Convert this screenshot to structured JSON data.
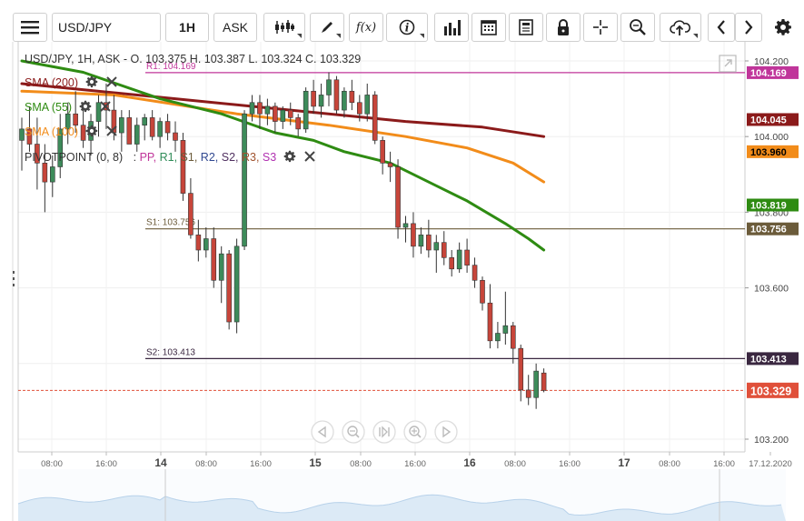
{
  "toolbar": {
    "menu_icon": "hamburger-menu-icon",
    "symbol": "USD/JPY",
    "timeframe": "1H",
    "price_type": "ASK",
    "chart_type_icon": "candlestick-chart-icon",
    "draw_icon": "pencil-icon",
    "indicator_label": "f(x)",
    "info_icon": "info-icon",
    "volume_icon": "bar-chart-icon",
    "calendar_icon": "calendar-icon",
    "news_icon": "news-icon",
    "lock_icon": "lock-icon",
    "crosshair_icon": "crosshair-icon",
    "zoom_icon": "zoom-search-icon",
    "upload_icon": "cloud-upload-icon",
    "prev_icon": "chevron-left-icon",
    "next_icon": "chevron-right-icon",
    "settings_icon": "gear-icon"
  },
  "chart_header": {
    "text": "USD/JPY, 1H, ASK - O. 103.375 H. 103.387 L. 103.324 C. 103.329"
  },
  "indicators": [
    {
      "name": "SMA (200)",
      "color": "#8b1a1a"
    },
    {
      "name": "SMA (55)",
      "color": "#2e8b12"
    },
    {
      "name": "SMA (100)",
      "color": "#f28c1a"
    }
  ],
  "pivot": {
    "title": "PIVOTPOINT (0, 8)",
    "separator": ":",
    "items": [
      {
        "label": "PP,",
        "color": "#c0359a"
      },
      {
        "label": "R1,",
        "color": "#2e8b57"
      },
      {
        "label": "S1,",
        "color": "#6b5b3a"
      },
      {
        "label": "R2,",
        "color": "#304890"
      },
      {
        "label": "S2,",
        "color": "#503060"
      },
      {
        "label": "R3,",
        "color": "#a0522d"
      },
      {
        "label": "S3",
        "color": "#b030b0"
      }
    ]
  },
  "levels": {
    "r1_label": "R1: 104.169",
    "s1_label": "S1: 103.756",
    "s2_label": "S2: 103.413"
  },
  "price_axis": {
    "ticks": [
      "104.200",
      "104.000",
      "103.800",
      "103.600",
      "103.200"
    ],
    "badges": [
      {
        "value": "104.169",
        "price": 104.169,
        "bg": "#c0359a",
        "fg": "#fff"
      },
      {
        "value": "104.045",
        "price": 104.045,
        "bg": "#8b1a1a",
        "fg": "#fff"
      },
      {
        "value": "103.960",
        "price": 103.96,
        "bg": "#f28c1a",
        "fg": "#000"
      },
      {
        "value": "103.819",
        "price": 103.819,
        "bg": "#2e8b12",
        "fg": "#fff"
      },
      {
        "value": "103.756",
        "price": 103.756,
        "bg": "#6b5b3a",
        "fg": "#fff"
      },
      {
        "value": "103.413",
        "price": 103.413,
        "bg": "#3a2740",
        "fg": "#fff"
      },
      {
        "value": "103.329",
        "price": 103.329,
        "bg": "#e0503a",
        "fg": "#fff"
      }
    ]
  },
  "time_axis": {
    "labels": [
      "08:00",
      "16:00",
      "14",
      "08:00",
      "16:00",
      "15",
      "08:00",
      "16:00",
      "16",
      "08:00",
      "16:00",
      "17",
      "08:00",
      "16:00",
      "17.12.2020"
    ]
  },
  "nav_controls": [
    "scroll-left-icon",
    "zoom-out-icon",
    "fit-icon",
    "zoom-in-icon",
    "scroll-right-icon"
  ],
  "colors": {
    "bull": "#3d8b5a",
    "bear": "#c7453a",
    "grid": "#ececec",
    "last_price_line": "#e0503a"
  },
  "chart_data": {
    "type": "candlestick",
    "symbol": "USD/JPY",
    "timeframe": "1H",
    "ylim": [
      103.18,
      104.24
    ],
    "candles": [
      {
        "o": 103.99,
        "h": 104.05,
        "l": 103.91,
        "c": 104.02
      },
      {
        "o": 104.02,
        "h": 104.08,
        "l": 103.96,
        "c": 103.98
      },
      {
        "o": 103.98,
        "h": 104.05,
        "l": 103.86,
        "c": 103.93
      },
      {
        "o": 103.93,
        "h": 103.98,
        "l": 103.8,
        "c": 103.88
      },
      {
        "o": 103.88,
        "h": 103.95,
        "l": 103.84,
        "c": 103.92
      },
      {
        "o": 103.92,
        "h": 104.06,
        "l": 103.89,
        "c": 104.02
      },
      {
        "o": 104.02,
        "h": 104.09,
        "l": 103.98,
        "c": 104.06
      },
      {
        "o": 104.06,
        "h": 104.12,
        "l": 104.01,
        "c": 104.03
      },
      {
        "o": 104.03,
        "h": 104.09,
        "l": 103.97,
        "c": 103.99
      },
      {
        "o": 103.99,
        "h": 104.06,
        "l": 103.95,
        "c": 104.04
      },
      {
        "o": 104.04,
        "h": 104.11,
        "l": 104.0,
        "c": 104.09
      },
      {
        "o": 104.09,
        "h": 104.14,
        "l": 104.02,
        "c": 104.07
      },
      {
        "o": 104.07,
        "h": 104.11,
        "l": 103.99,
        "c": 104.01
      },
      {
        "o": 104.01,
        "h": 104.07,
        "l": 103.96,
        "c": 104.05
      },
      {
        "o": 104.05,
        "h": 104.07,
        "l": 103.98,
        "c": 103.98
      },
      {
        "o": 103.98,
        "h": 104.05,
        "l": 103.96,
        "c": 104.03
      },
      {
        "o": 104.03,
        "h": 104.06,
        "l": 103.99,
        "c": 104.05
      },
      {
        "o": 104.05,
        "h": 104.07,
        "l": 103.99,
        "c": 104.0
      },
      {
        "o": 104.0,
        "h": 104.05,
        "l": 103.97,
        "c": 104.04
      },
      {
        "o": 104.04,
        "h": 104.06,
        "l": 103.99,
        "c": 104.01
      },
      {
        "o": 104.01,
        "h": 104.04,
        "l": 103.96,
        "c": 103.99
      },
      {
        "o": 103.99,
        "h": 104.01,
        "l": 103.83,
        "c": 103.85
      },
      {
        "o": 103.85,
        "h": 103.89,
        "l": 103.73,
        "c": 103.74
      },
      {
        "o": 103.74,
        "h": 103.78,
        "l": 103.67,
        "c": 103.7
      },
      {
        "o": 103.7,
        "h": 103.76,
        "l": 103.68,
        "c": 103.73
      },
      {
        "o": 103.73,
        "h": 103.76,
        "l": 103.6,
        "c": 103.62
      },
      {
        "o": 103.62,
        "h": 103.71,
        "l": 103.56,
        "c": 103.69
      },
      {
        "o": 103.69,
        "h": 103.7,
        "l": 103.49,
        "c": 103.51
      },
      {
        "o": 103.51,
        "h": 103.73,
        "l": 103.48,
        "c": 103.71
      },
      {
        "o": 103.71,
        "h": 104.07,
        "l": 103.7,
        "c": 104.06
      },
      {
        "o": 104.06,
        "h": 104.11,
        "l": 104.04,
        "c": 104.09
      },
      {
        "o": 104.09,
        "h": 104.11,
        "l": 104.02,
        "c": 104.06
      },
      {
        "o": 104.06,
        "h": 104.1,
        "l": 104.03,
        "c": 104.08
      },
      {
        "o": 104.08,
        "h": 104.09,
        "l": 104.01,
        "c": 104.04
      },
      {
        "o": 104.04,
        "h": 104.08,
        "l": 104.02,
        "c": 104.07
      },
      {
        "o": 104.07,
        "h": 104.09,
        "l": 104.03,
        "c": 104.05
      },
      {
        "o": 104.05,
        "h": 104.06,
        "l": 104.0,
        "c": 104.02
      },
      {
        "o": 104.02,
        "h": 104.13,
        "l": 104.01,
        "c": 104.12
      },
      {
        "o": 104.12,
        "h": 104.15,
        "l": 104.06,
        "c": 104.08
      },
      {
        "o": 104.08,
        "h": 104.14,
        "l": 104.05,
        "c": 104.11
      },
      {
        "o": 104.11,
        "h": 104.17,
        "l": 104.08,
        "c": 104.15
      },
      {
        "o": 104.15,
        "h": 104.16,
        "l": 104.06,
        "c": 104.07
      },
      {
        "o": 104.07,
        "h": 104.13,
        "l": 104.05,
        "c": 104.12
      },
      {
        "o": 104.12,
        "h": 104.15,
        "l": 104.07,
        "c": 104.09
      },
      {
        "o": 104.09,
        "h": 104.11,
        "l": 104.04,
        "c": 104.06
      },
      {
        "o": 104.06,
        "h": 104.14,
        "l": 104.04,
        "c": 104.11
      },
      {
        "o": 104.11,
        "h": 104.12,
        "l": 103.98,
        "c": 103.99
      },
      {
        "o": 103.99,
        "h": 104.0,
        "l": 103.9,
        "c": 103.93
      },
      {
        "o": 103.93,
        "h": 103.96,
        "l": 103.88,
        "c": 103.92
      },
      {
        "o": 103.92,
        "h": 103.94,
        "l": 103.73,
        "c": 103.76
      },
      {
        "o": 103.76,
        "h": 103.79,
        "l": 103.72,
        "c": 103.77
      },
      {
        "o": 103.77,
        "h": 103.8,
        "l": 103.68,
        "c": 103.71
      },
      {
        "o": 103.71,
        "h": 103.76,
        "l": 103.69,
        "c": 103.74
      },
      {
        "o": 103.74,
        "h": 103.78,
        "l": 103.68,
        "c": 103.7
      },
      {
        "o": 103.7,
        "h": 103.74,
        "l": 103.64,
        "c": 103.72
      },
      {
        "o": 103.72,
        "h": 103.75,
        "l": 103.66,
        "c": 103.68
      },
      {
        "o": 103.68,
        "h": 103.7,
        "l": 103.63,
        "c": 103.65
      },
      {
        "o": 103.65,
        "h": 103.72,
        "l": 103.64,
        "c": 103.7
      },
      {
        "o": 103.7,
        "h": 103.73,
        "l": 103.64,
        "c": 103.66
      },
      {
        "o": 103.66,
        "h": 103.68,
        "l": 103.6,
        "c": 103.62
      },
      {
        "o": 103.62,
        "h": 103.63,
        "l": 103.54,
        "c": 103.56
      },
      {
        "o": 103.56,
        "h": 103.61,
        "l": 103.44,
        "c": 103.46
      },
      {
        "o": 103.46,
        "h": 103.51,
        "l": 103.44,
        "c": 103.48
      },
      {
        "o": 103.48,
        "h": 103.59,
        "l": 103.45,
        "c": 103.5
      },
      {
        "o": 103.5,
        "h": 103.51,
        "l": 103.4,
        "c": 103.44
      },
      {
        "o": 103.44,
        "h": 103.45,
        "l": 103.3,
        "c": 103.33
      },
      {
        "o": 103.33,
        "h": 103.37,
        "l": 103.29,
        "c": 103.31
      },
      {
        "o": 103.31,
        "h": 103.4,
        "l": 103.28,
        "c": 103.38
      },
      {
        "o": 103.375,
        "h": 103.387,
        "l": 103.324,
        "c": 103.329
      }
    ],
    "sma": [
      {
        "name": "SMA (200)",
        "color": "#8b1a1a",
        "points": [
          [
            0,
            104.14
          ],
          [
            20,
            104.1
          ],
          [
            35,
            104.07
          ],
          [
            50,
            104.04
          ],
          [
            60,
            104.025
          ],
          [
            68,
            104.0
          ]
        ]
      },
      {
        "name": "SMA (100)",
        "color": "#f28c1a",
        "points": [
          [
            0,
            104.12
          ],
          [
            12,
            104.11
          ],
          [
            28,
            104.06
          ],
          [
            40,
            104.03
          ],
          [
            50,
            104.0
          ],
          [
            58,
            103.97
          ],
          [
            64,
            103.93
          ],
          [
            68,
            103.88
          ]
        ]
      },
      {
        "name": "SMA (55)",
        "color": "#2e8b12",
        "points": [
          [
            0,
            104.2
          ],
          [
            8,
            104.17
          ],
          [
            18,
            104.1
          ],
          [
            26,
            104.06
          ],
          [
            33,
            104.01
          ],
          [
            38,
            103.99
          ],
          [
            42,
            103.96
          ],
          [
            48,
            103.93
          ],
          [
            54,
            103.87
          ],
          [
            58,
            103.83
          ],
          [
            63,
            103.77
          ],
          [
            66,
            103.73
          ],
          [
            68,
            103.7
          ]
        ]
      }
    ]
  }
}
